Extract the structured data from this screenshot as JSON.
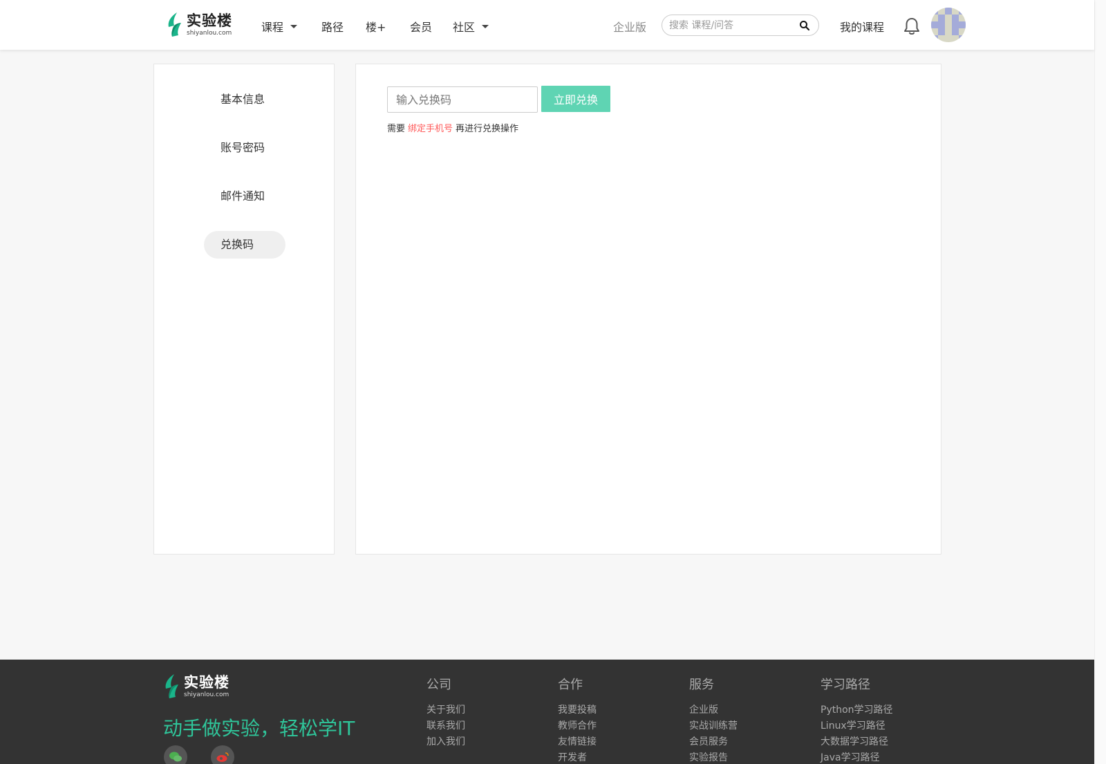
{
  "brand": {
    "name_cn": "实验楼",
    "domain": "shiyanlou.com",
    "accent": "#2fc59a"
  },
  "nav": {
    "items": [
      {
        "label": "课程",
        "dropdown": true
      },
      {
        "label": "路径",
        "dropdown": false
      },
      {
        "label": "楼+",
        "dropdown": false
      },
      {
        "label": "会员",
        "dropdown": false
      },
      {
        "label": "社区",
        "dropdown": true
      }
    ],
    "enterprise": "企业版",
    "search_placeholder": "搜索 课程/问答",
    "my_courses": "我的课程"
  },
  "sidebar": {
    "items": [
      {
        "label": "基本信息"
      },
      {
        "label": "账号密码"
      },
      {
        "label": "邮件通知"
      },
      {
        "label": "兑换码",
        "active": true
      }
    ]
  },
  "redeem": {
    "input_placeholder": "输入兑换码",
    "button_label": "立即兑换",
    "hint_prefix": "需要",
    "hint_link": "绑定手机号",
    "hint_suffix": "再进行兑换操作",
    "button_color": "#5fd4b3",
    "link_color": "#ff5a5a"
  },
  "footer": {
    "slogan": "动手做实验，轻松学IT",
    "columns": [
      {
        "title": "公司",
        "links": [
          "关于我们",
          "联系我们",
          "加入我们"
        ]
      },
      {
        "title": "合作",
        "links": [
          "我要投稿",
          "教师合作",
          "友情链接",
          "开发者"
        ]
      },
      {
        "title": "服务",
        "links": [
          "企业版",
          "实战训练营",
          "会员服务",
          "实验报告"
        ]
      },
      {
        "title": "学习路径",
        "links": [
          "Python学习路径",
          "Linux学习路径",
          "大数据学习路径",
          "Java学习路径"
        ]
      }
    ],
    "social": [
      "wechat-icon",
      "weibo-icon"
    ]
  }
}
